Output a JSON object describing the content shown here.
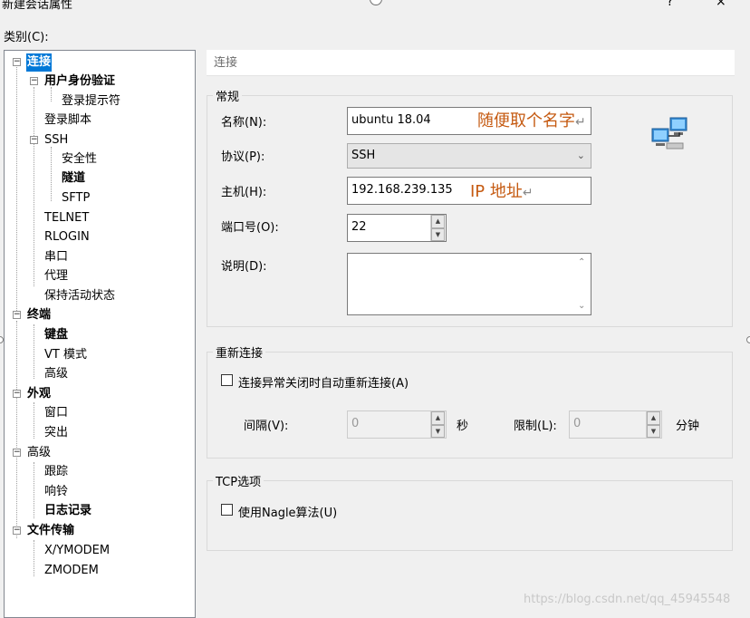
{
  "window": {
    "title": "新建会话属性",
    "help": "?",
    "close": "×"
  },
  "category_label": "类别(C):",
  "tree": {
    "connection": "连接",
    "auth": "用户身份验证",
    "login_prompt": "登录提示符",
    "login_script": "登录脚本",
    "ssh": "SSH",
    "security": "安全性",
    "tunnel": "隧道",
    "sftp": "SFTP",
    "telnet": "TELNET",
    "rlogin": "RLOGIN",
    "serial": "串口",
    "proxy": "代理",
    "keepalive": "保持活动状态",
    "terminal": "终端",
    "keyboard": "键盘",
    "vt_mode": "VT 模式",
    "advanced": "高级",
    "appearance": "外观",
    "window": "窗口",
    "highlight": "突出",
    "advanced2": "高级",
    "trace": "跟踪",
    "bell": "响铃",
    "logging": "日志记录",
    "file_transfer": "文件传输",
    "xymodem": "X/YMODEM",
    "zmodem": "ZMODEM",
    "expand_minus": "−"
  },
  "header": {
    "title": "连接"
  },
  "general": {
    "title": "常规",
    "name_label": "名称(N):",
    "name_value": "ubuntu 18.04",
    "name_note": "随便取个名字",
    "protocol_label": "协议(P):",
    "protocol_value": "SSH",
    "host_label": "主机(H):",
    "host_value": "192.168.239.135",
    "host_note": "IP 地址",
    "port_label": "端口号(O):",
    "port_value": "22",
    "desc_label": "说明(D):",
    "return_mark": "↵"
  },
  "reconnect": {
    "title": "重新连接",
    "checkbox_label": "连接异常关闭时自动重新连接(A)",
    "interval_label": "间隔(V):",
    "interval_value": "0",
    "interval_unit": "秒",
    "limit_label": "限制(L):",
    "limit_value": "0",
    "limit_unit": "分钟"
  },
  "tcp": {
    "title": "TCP选项",
    "nagle_label": "使用Nagle算法(U)"
  },
  "watermark": "https://blog.csdn.net/qq_45945548",
  "colors": {
    "selection": "#0078d7",
    "note": "#c55a11"
  }
}
